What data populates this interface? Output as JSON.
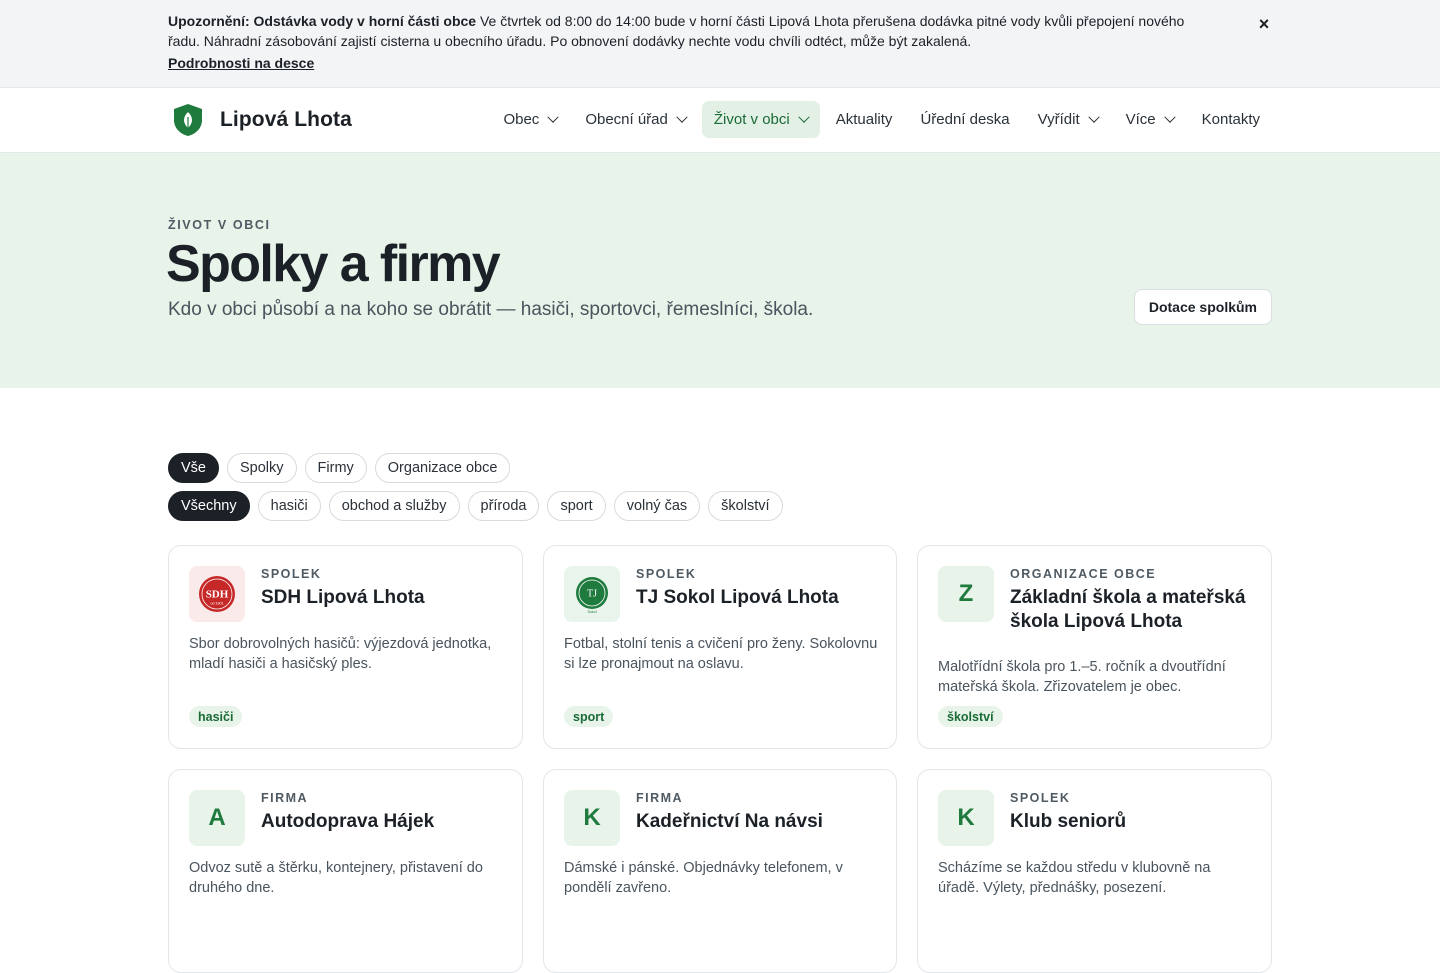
{
  "alert": {
    "title": "Upozornění: Odstávka vody v horní části obce",
    "text": " Ve čtvrtek od 8:00 do 14:00 bude v horní části Lipová Lhota přerušena dodávka pitné vody kvůli přepojení nového řadu. Náhradní zásobování zajistí cisterna u obecního úřadu. Po obnovení dodávky nechte vodu chvíli odtéct, může být zakalená.",
    "link": "Podrobnosti na desce",
    "close_icon": "×"
  },
  "header": {
    "brand": "Lipová Lhota",
    "brand_color": "#1f7a3d",
    "nav": [
      {
        "label": "Obec",
        "dropdown": true
      },
      {
        "label": "Obecní úřad",
        "dropdown": true
      },
      {
        "label": "Život v obci",
        "dropdown": true,
        "active": true
      },
      {
        "label": "Aktuality",
        "dropdown": false
      },
      {
        "label": "Úřední deska",
        "dropdown": false
      },
      {
        "label": "Vyřídit",
        "dropdown": true
      },
      {
        "label": "Více",
        "dropdown": true
      },
      {
        "label": "Kontakty",
        "dropdown": false
      }
    ]
  },
  "hero": {
    "eyebrow": "ŽIVOT V OBCI",
    "title": "Spolky a firmy",
    "subtitle": "Kdo v obci působí a na koho se obrátit — hasiči, sportovci, řemeslníci, škola.",
    "button": "Dotace spolkům"
  },
  "filters": {
    "types": [
      {
        "label": "Vše",
        "active": true
      },
      {
        "label": "Spolky"
      },
      {
        "label": "Firmy"
      },
      {
        "label": "Organizace obce"
      }
    ],
    "categories": [
      {
        "label": "Všechny",
        "active": true
      },
      {
        "label": "hasiči"
      },
      {
        "label": "obchod a služby"
      },
      {
        "label": "příroda"
      },
      {
        "label": "sport"
      },
      {
        "label": "volný čas"
      },
      {
        "label": "školství"
      }
    ]
  },
  "cards": [
    {
      "type": "SPOLEK",
      "title": "SDH Lipová Lhota",
      "desc": "Sbor dobrovolných hasičů: výjezdová jednotka, mladí hasiči a hasičský ples.",
      "tag": "hasiči",
      "logo": "sdh",
      "logo_text": "SDH",
      "logo_sub": "od 1901"
    },
    {
      "type": "SPOLEK",
      "title": "TJ Sokol Lipová Lhota",
      "desc": "Fotbal, stolní tenis a cvičení pro ženy. Sokolovnu si lze pronajmout na oslavu.",
      "tag": "sport",
      "logo": "tj",
      "logo_text": "TJ",
      "logo_sub": "Sokol"
    },
    {
      "type": "ORGANIZACE OBCE",
      "title": "Základní škola a mateřská škola Lipová Lhota",
      "desc": "Malotřídní škola pro 1.–5. ročník a dvoutřídní mateřská škola. Zřizovatelem je obec.",
      "tag": "školství",
      "logo": "letter",
      "letter": "Z"
    },
    {
      "type": "FIRMA",
      "title": "Autodoprava Hájek",
      "desc": "Odvoz sutě a štěrku, kontejnery, přistavení do druhého dne.",
      "logo": "letter",
      "letter": "A"
    },
    {
      "type": "FIRMA",
      "title": "Kadeřnictví Na návsi",
      "desc": "Dámské i pánské. Objednávky telefonem, v pondělí zavřeno.",
      "logo": "letter",
      "letter": "K"
    },
    {
      "type": "SPOLEK",
      "title": "Klub seniorů",
      "desc": "Scházíme se každou středu v klubovně na úřadě. Výlety, přednášky, posezení.",
      "logo": "letter",
      "letter": "K"
    }
  ]
}
